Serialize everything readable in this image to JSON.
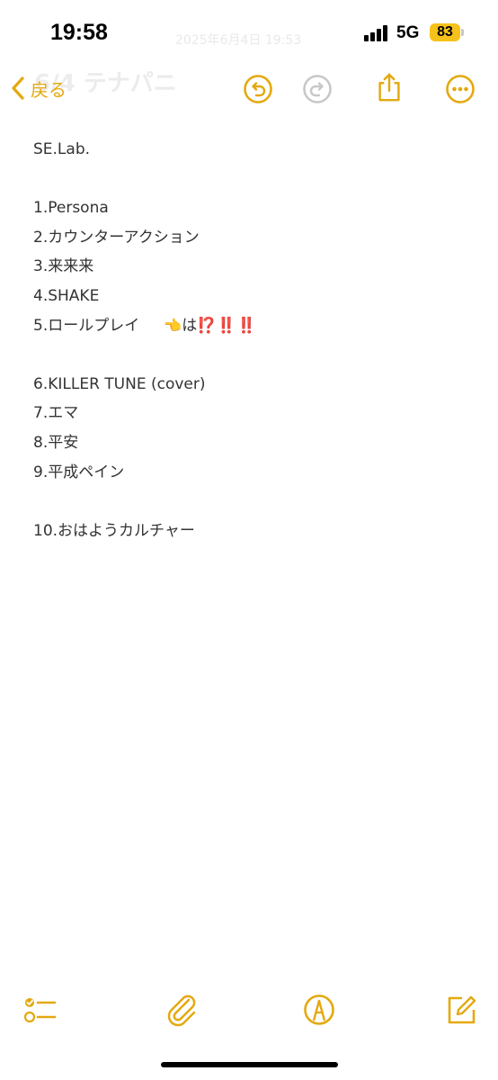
{
  "status": {
    "time": "19:58",
    "network": "5G",
    "battery": "83",
    "faded_date": "2025年6月4日 19:53"
  },
  "nav": {
    "faded_title": "6/4 テナパニ",
    "back_label": "戻る"
  },
  "note": {
    "lines": [
      "SE.Lab.",
      "",
      "1.Persona",
      "2.カウンターアクション",
      "3.来来来",
      "4.SHAKE",
      "5.ロールプレイ",
      "",
      "6.KILLER TUNE (cover)",
      "7.エマ",
      "8.平安",
      "9.平成ペイン",
      "",
      "10.おはようカルチャー"
    ],
    "line5_suffix_char": "は",
    "line5_marks": "⁉️‼️‼️",
    "line5_hand": "👈"
  },
  "colors": {
    "accent": "#e4a90f",
    "battery": "#f6c21a",
    "text": "#333333",
    "disabled": "#c8c8c8"
  },
  "icons": [
    "undo-icon",
    "redo-icon",
    "share-icon",
    "more-icon",
    "checklist-icon",
    "attachment-icon",
    "markup-icon",
    "compose-icon"
  ]
}
